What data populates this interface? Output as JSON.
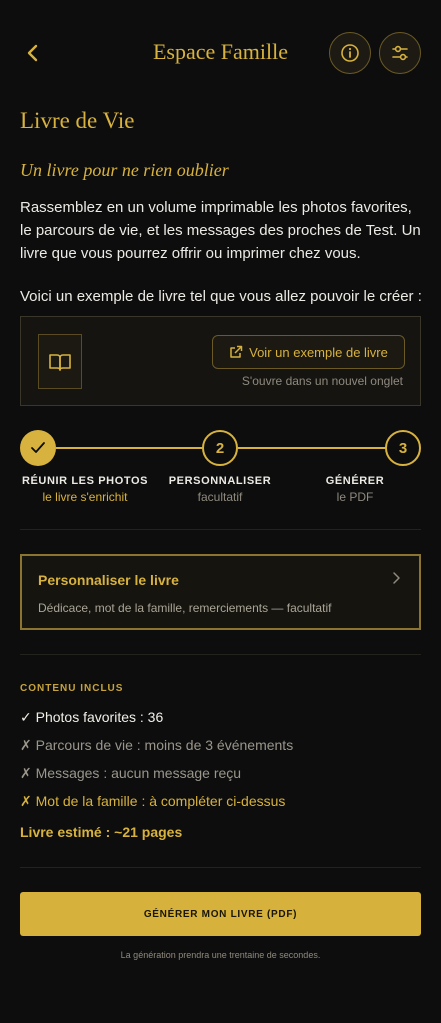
{
  "header": {
    "title": "Espace Famille",
    "back_icon": "chevron-left-icon",
    "info_icon": "info-icon",
    "filter_icon": "sliders-icon"
  },
  "page": {
    "title": "Livre de Vie",
    "tagline": "Un livre pour ne rien oublier",
    "intro": "Rassemblez en un volume imprimable les photos favorites, le parcours de vie, et les messages des proches de Test. Un livre que vous pourrez offrir ou imprimer chez vous.",
    "example_label": "Voici un exemple de livre tel que vous allez pouvoir le créer :"
  },
  "example": {
    "book_icon": "open-book-icon",
    "button_label": "Voir un exemple de livre",
    "button_icon": "external-link-icon",
    "note": "S'ouvre dans un nouvel onglet"
  },
  "steps": [
    {
      "number": "1",
      "title": "RÉUNIR LES PHOTOS",
      "subtitle": "le livre s'enrichit",
      "status": "done"
    },
    {
      "number": "2",
      "title": "PERSONNALISER",
      "subtitle": "facultatif",
      "status": "todo"
    },
    {
      "number": "3",
      "title": "GÉNÉRER",
      "subtitle": "le PDF",
      "status": "todo"
    }
  ],
  "personalize": {
    "title": "Personnaliser le livre",
    "subtitle": "Dédicace, mot de la famille, remerciements — facultatif"
  },
  "contents": {
    "label": "CONTENU INCLUS",
    "items": [
      {
        "text": "✓ Photos favorites : 36",
        "state": "ok"
      },
      {
        "text": "✗ Parcours de vie : moins de 3 événements",
        "state": "missing"
      },
      {
        "text": "✗ Messages : aucun message reçu",
        "state": "missing"
      },
      {
        "text": "✗ Mot de la famille : à compléter ci-dessus",
        "state": "warning"
      }
    ],
    "estimate": "Livre estimé : ~21 pages"
  },
  "generate": {
    "button_label": "GÉNÉRER MON LIVRE (PDF)",
    "note": "La génération prendra une trentaine de secondes."
  },
  "colors": {
    "background": "#0d0d0d",
    "accent": "#d8b23e",
    "text": "#eceae4",
    "muted": "#9a968b"
  }
}
